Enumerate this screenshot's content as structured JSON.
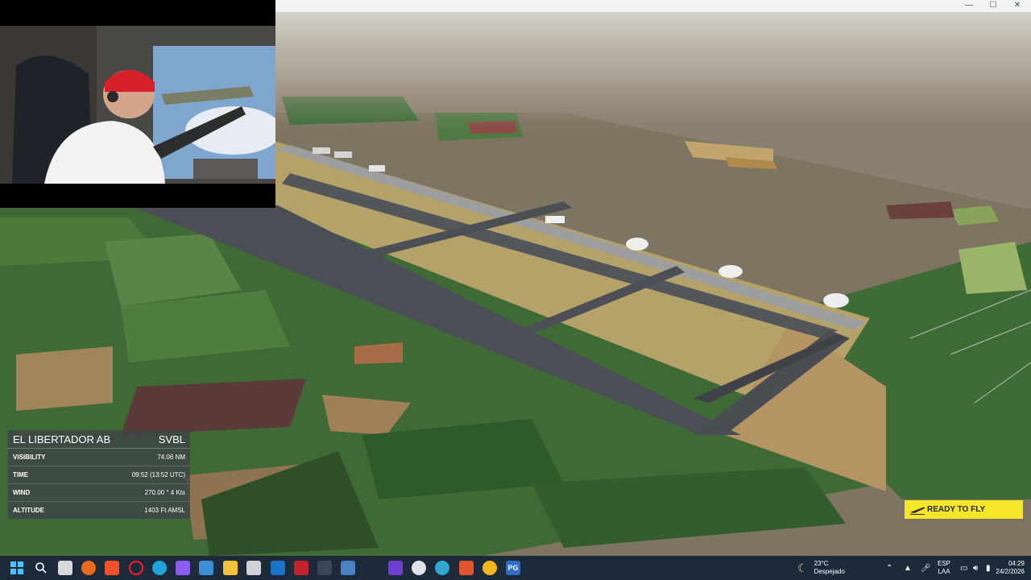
{
  "window": {
    "minimize": "—",
    "maximize": "☐",
    "close": "✕"
  },
  "airport_panel": {
    "name": "EL LIBERTADOR AB",
    "icao": "SVBL",
    "rows": [
      {
        "label": "VISIBILITY",
        "value": "74.06 NM"
      },
      {
        "label": "TIME",
        "value": "09:52 (13:52 UTC)"
      },
      {
        "label": "WIND",
        "value": "270.00 ° 4 Kts"
      },
      {
        "label": "ALTITUDE",
        "value": "1403 Ft AMSL"
      }
    ]
  },
  "ready_button": {
    "label": "READY TO FLY"
  },
  "taskbar": {
    "weather": {
      "temp": "23°C",
      "condition": "Despejado"
    },
    "language": {
      "line1": "ESP",
      "line2": "LAA"
    },
    "clock": {
      "time": "04:29",
      "date": "24/2/2026"
    },
    "apps": [
      "start-icon",
      "search-icon",
      "task-view-icon",
      "firefox-icon",
      "brave-icon",
      "opera-icon",
      "edge-icon",
      "copilot-icon",
      "remote-desktop-icon",
      "file-explorer-icon",
      "store-icon",
      "outlook-icon",
      "app-red-icon",
      "flight-sim-icon",
      "app-blue-icon",
      "vpn-icon",
      "steam-icon",
      "globe-icon",
      "office-icon",
      "sun-app-icon",
      "pg-icon"
    ],
    "pg_label": "PG"
  }
}
